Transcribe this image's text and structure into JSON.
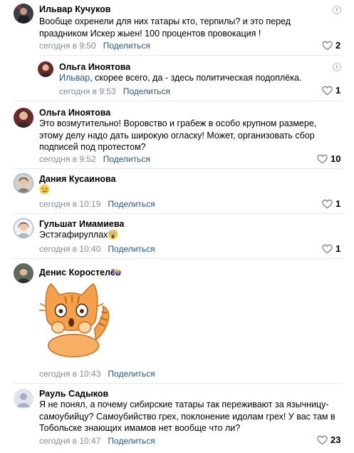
{
  "share_label": "Поделиться",
  "comments": [
    {
      "author": "Ильвар Кучуков",
      "text": "Вообще охренели для них татары кто, терпилы? и это перед праздником Искер жыен! 100 процентов провокация !",
      "time": "сегодня в 9:50",
      "likes": "2"
    },
    {
      "author": "Ольга Иноятова",
      "reply_to": "Ильвар",
      "text": ", скорее всего, да - здесь политическая подоплёка.",
      "time": "сегодня в 9:53",
      "likes": "1"
    },
    {
      "author": "Ольга Иноятова",
      "text": "Это возмутительно! Воровство и грабеж в особо крупном размере, этому делу надо дать широкую огласку! Может, организовать сбор подписей под протестом?",
      "time": "сегодня в 9:52",
      "likes": "10"
    },
    {
      "author": "Дания Кусаинова",
      "emoji": "sad-face-emoji",
      "time": "сегодня в 10:19",
      "likes": "1"
    },
    {
      "author": "Гульшат Имамиева",
      "text": "Эстэгафируллах",
      "emoji": "screaming-face-emoji",
      "time": "сегодня в 10:40",
      "likes": "1"
    },
    {
      "author": "Денис Коростелёв",
      "sticker": "scared-cat-sticker",
      "time": "сегодня в 10:43",
      "likes": ""
    },
    {
      "author": "Рауль Садыков",
      "text": "Я не понял, а почему сибирские татары так переживают за язычницу-самоубийцу? Самоубийство грех, поклонение идолам грех! У вас там в Тобольске знающих имамов нет вообще что ли?",
      "time": "сегодня в 10:47",
      "likes": "23"
    }
  ],
  "colors": {
    "link": "#2a5885",
    "meta": "#818c99",
    "divider": "#e7e8ec",
    "sticker_orange": "#f5a04a"
  }
}
